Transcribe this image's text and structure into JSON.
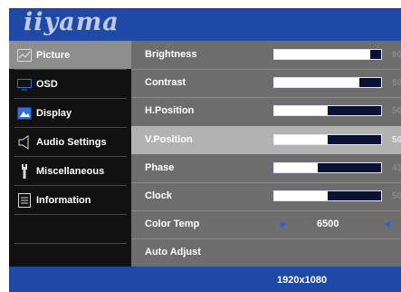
{
  "brand": {
    "logo_text": "iiyama"
  },
  "sidebar": {
    "items": [
      {
        "label": "Picture",
        "icon": "picture-icon",
        "active": true
      },
      {
        "label": "OSD",
        "icon": "osd-icon",
        "active": false
      },
      {
        "label": "Display",
        "icon": "display-icon",
        "active": false
      },
      {
        "label": "Audio Settings",
        "icon": "speaker-icon",
        "active": false
      },
      {
        "label": "Miscellaneous",
        "icon": "wrench-icon",
        "active": false
      },
      {
        "label": "Information",
        "icon": "document-icon",
        "active": false
      }
    ]
  },
  "picture_menu": {
    "rows": [
      {
        "label": "Brightness",
        "value": "90",
        "level_pct": 90
      },
      {
        "label": "Contrast",
        "value": "80",
        "level_pct": 80
      },
      {
        "label": "H.Position",
        "value": "50",
        "level_pct": 50
      },
      {
        "label": "V.Position",
        "value": "50",
        "level_pct": 50,
        "selected": true
      },
      {
        "label": "Phase",
        "value": "41",
        "level_pct": 41
      },
      {
        "label": "Clock",
        "value": "50",
        "level_pct": 50
      }
    ],
    "color_temp": {
      "label": "Color Temp",
      "value": "6500"
    },
    "auto_adjust": {
      "label": "Auto Adjust"
    }
  },
  "status": {
    "resolution": "1920x1080"
  },
  "colors": {
    "background": "#1f49a6",
    "sidebar": "#111111",
    "menu_panel": "#6d6d6d",
    "selected_row": "#b2b2b2",
    "active_tab": "#8e8e8e",
    "arrow": "#2f5fd1"
  }
}
